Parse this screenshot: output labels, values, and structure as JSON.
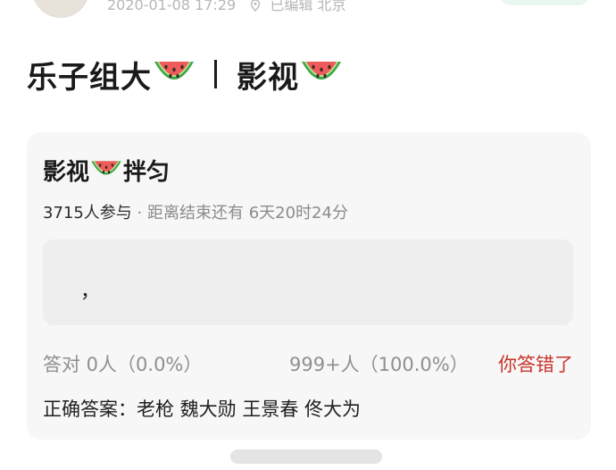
{
  "header": {
    "meta_text": "2020-01-08 17:29",
    "location_text": "已编辑 北京"
  },
  "post": {
    "title_left": "乐子组大",
    "title_right": "影视"
  },
  "vote": {
    "title_left": "影视",
    "title_right": "拌匀",
    "participants": "3715人参与",
    "remaining": " · 距离结束还有 6天20时24分",
    "option_text": "，",
    "correct_stat": "答对  0人（0.0%）",
    "wrong_stat": "999+人（100.0%）",
    "my_result": "你答错了",
    "answer_text": "正确答案：老枪 魏大勋 王景春 佟大为"
  },
  "colors": {
    "accent_wrong": "#c9322b",
    "follow_pill": "#e9f7ef",
    "card_bg": "#f7f7f7"
  },
  "icons": {
    "title_emoji": "watermelon-icon",
    "meta_icon": "location-pin-icon"
  }
}
